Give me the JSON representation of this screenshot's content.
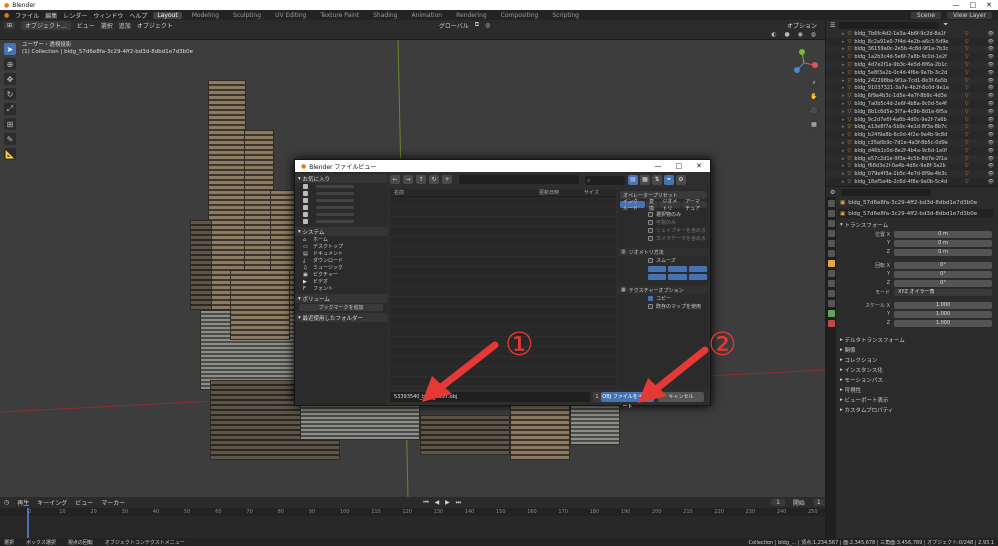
{
  "window": {
    "title": "Blender",
    "controls": [
      "—",
      "□",
      "✕"
    ]
  },
  "topbar": {
    "menus": [
      "ファイル",
      "編集",
      "レンダー",
      "ウィンドウ",
      "ヘルプ"
    ],
    "workspaces": [
      "Layout",
      "Modeling",
      "Sculpting",
      "UV Editing",
      "Texture Paint",
      "Shading",
      "Animation",
      "Rendering",
      "Compositing",
      "Scripting"
    ],
    "active_workspace": "Layout",
    "scene_label": "Scene",
    "viewlayer_label": "View Layer"
  },
  "viewport_header": {
    "mode": "オブジェクト...",
    "menus": [
      "ビュー",
      "選択",
      "追加",
      "オブジェクト"
    ],
    "orientation": "グローバル",
    "options_label": "オプション"
  },
  "viewport": {
    "info_line1": "ユーザー・透視投影",
    "info_line2": "(1) Collection | bldg_57d6e8fa-3c29-4ff2-bd3d-8dbd1e7d3b0e"
  },
  "timeline": {
    "menus": [
      "再生",
      "キーイング",
      "ビュー",
      "マーカー"
    ],
    "current_frame": "1",
    "start_label": "開始",
    "start": "1",
    "end_label": "終了",
    "end": "250",
    "ruler": [
      "0",
      "10",
      "20",
      "30",
      "40",
      "50",
      "60",
      "70",
      "80",
      "90",
      "100",
      "110",
      "120",
      "130",
      "140",
      "150",
      "160",
      "170",
      "180",
      "190",
      "200",
      "210",
      "220",
      "230",
      "240",
      "250"
    ]
  },
  "statusbar": {
    "items": [
      "選択",
      "ボックス選択",
      "視点の回転",
      "オブジェクトコンテクストメニュー"
    ],
    "right": "Collection | bldg_... | 頂点:1,234,567 | 面:2,345,678 | 三角面:3,456,789 | オブジェクト:0/248 | 2.93.1"
  },
  "outliner": {
    "search_placeholder": "",
    "items": [
      "bldg_7b6fc4d2-1e3a-4b6f-9c2d-8a1f",
      "bldg_8c2a91e0-7f4d-4e2b-a6c3-5d9e",
      "bldg_36159a0c-2e5b-4c8d-9f1a-7b3c",
      "bldg_1a2b3c4d-5e6f-7a8b-9c0d-1e2f",
      "bldg_4d7e2f1a-9b3c-4e5d-8f6a-2b1c",
      "bldg_5e8f3a2b-0c4d-4f6e-9a7b-3c2d",
      "bldg_242298ba-9f1a-7cd1-8e3f-6a5b",
      "bldg_91037321-3a7e-4b2f-8c0d-9e1a",
      "bldg_6f9a4b3c-1d5e-4a7f-8b9c-4d3e",
      "bldg_7a0b5c4d-2e6f-4b8a-9c0d-5e4f",
      "bldg_8b1c6d5e-3f7a-4c9b-8d1e-6f5a",
      "bldg_9c2d7e6f-4a8b-4d0c-9e2f-7a6b",
      "bldg_a13e8f7a-5b9c-4e1d-8f3a-8b7c",
      "bldg_b24f9a8b-6c0d-4f2e-9a4b-9c8d",
      "bldg_c35a0b9c-7d1e-4a3f-8b5c-0d9e",
      "bldg_d46b1c0d-8e2f-4b4a-9c6d-1e0f",
      "bldg_e57c2d1e-9f3a-4c5b-8d7e-2f1a",
      "bldg_f68d3e2f-0a4b-4d6c-9e8f-3a2b",
      "bldg_079e4f3a-1b5c-4e7d-8f9a-4b3c",
      "bldg_18af5a4b-2c6d-4f8e-9a0b-5c4d"
    ]
  },
  "properties": {
    "object_name": "bldg_57d6e8fa-3c29-4ff2-bd3d-8dbd1e7d3b0e",
    "mesh_name": "bldg_57d6e8fa-3c29-4ff2-bd3d-8dbd1e7d3b0e",
    "transform_label": "トランスフォーム",
    "location_label": "位置 X",
    "rotation_label": "回転 X",
    "mode_label": "モード",
    "mode_value": "XYZ オイラー角",
    "scale_label": "スケール X",
    "y_label": "Y",
    "z_label": "Z",
    "location": [
      "0 m",
      "0 m",
      "0 m"
    ],
    "rotation": [
      "0°",
      "0°",
      "0°"
    ],
    "scale": [
      "1.000",
      "1.000",
      "1.000"
    ],
    "sections": [
      "デルタトランスフォーム",
      "関係",
      "コレクション",
      "インスタンス化",
      "モーションパス",
      "可視性",
      "ビューポート表示",
      "カスタムプロパティ"
    ]
  },
  "dialog": {
    "title": "Blender ファイルビュー",
    "controls": [
      "—",
      "□",
      "✕"
    ],
    "favorites_label": "お気に入り",
    "favorites": [
      "",
      "",
      "",
      "",
      "",
      ""
    ],
    "system_label": "システム",
    "system": [
      "ホーム",
      "デスクトップ",
      "ドキュメント",
      "ダウンロード",
      "ミュージック",
      "ピクチャー",
      "ビデオ",
      "フォント"
    ],
    "volumes_label": "ボリューム",
    "add_bookmark": "ブックマークを追加",
    "recent_label": "最近使用したフォルダー",
    "path": "",
    "search_placeholder": "",
    "col_name": "名前",
    "col_date": "更新日時",
    "col_size": "サイズ",
    "operator_preset": "オペレータープリセット",
    "tabs": [
      "インクルード",
      "変換",
      "ジオメトリ",
      "アーマチュア"
    ],
    "include_opts": [
      "選択物のみ",
      "可視のみ",
      "シェイプキーを含める",
      "カメラデータを含める"
    ],
    "geometry_label": "ジオメトリ方法",
    "geometry_opts": [
      "スムーズ"
    ],
    "texture_label": "テクスチャーオプション",
    "texture_opts": [
      "コピー",
      "既存のマップを使用"
    ],
    "filename": "53393540_bldg_6697.obj",
    "file_count": "1",
    "import_button": "OBJ ファイルをインポート",
    "cancel_button": "キャンセル"
  },
  "annotations": {
    "one": "①",
    "two": "②",
    "arrow_color": "#e53935"
  }
}
